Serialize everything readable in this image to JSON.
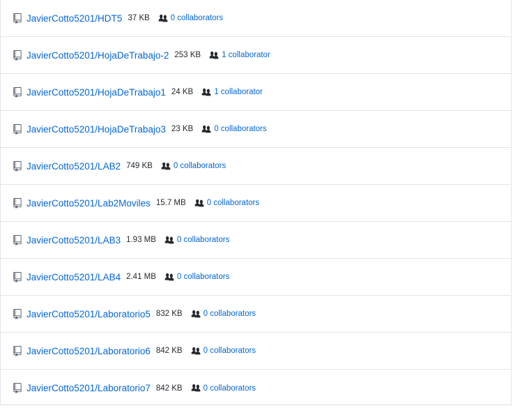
{
  "repos": [
    {
      "name": "JavierCotto5201/HDT5",
      "size": "37 KB",
      "collaborators": "0 collaborators"
    },
    {
      "name": "JavierCotto5201/HojaDeTrabajo-2",
      "size": "253 KB",
      "collaborators": "1 collaborator"
    },
    {
      "name": "JavierCotto5201/HojaDeTrabajo1",
      "size": "24 KB",
      "collaborators": "1 collaborator"
    },
    {
      "name": "JavierCotto5201/HojaDeTrabajo3",
      "size": "23 KB",
      "collaborators": "0 collaborators"
    },
    {
      "name": "JavierCotto5201/LAB2",
      "size": "749 KB",
      "collaborators": "0 collaborators"
    },
    {
      "name": "JavierCotto5201/Lab2Moviles",
      "size": "15.7 MB",
      "collaborators": "0 collaborators"
    },
    {
      "name": "JavierCotto5201/LAB3",
      "size": "1.93 MB",
      "collaborators": "0 collaborators"
    },
    {
      "name": "JavierCotto5201/LAB4",
      "size": "2.41 MB",
      "collaborators": "0 collaborators"
    },
    {
      "name": "JavierCotto5201/Laboratorio5",
      "size": "832 KB",
      "collaborators": "0 collaborators"
    },
    {
      "name": "JavierCotto5201/Laboratorio6",
      "size": "842 KB",
      "collaborators": "0 collaborators"
    },
    {
      "name": "JavierCotto5201/Laboratorio7",
      "size": "842 KB",
      "collaborators": "0 collaborators"
    }
  ],
  "icons": {
    "repo": "repo-icon",
    "collaborators": "people-icon"
  },
  "colors": {
    "link": "#0366d6",
    "text": "#24292e",
    "border": "#e1e4e8"
  }
}
